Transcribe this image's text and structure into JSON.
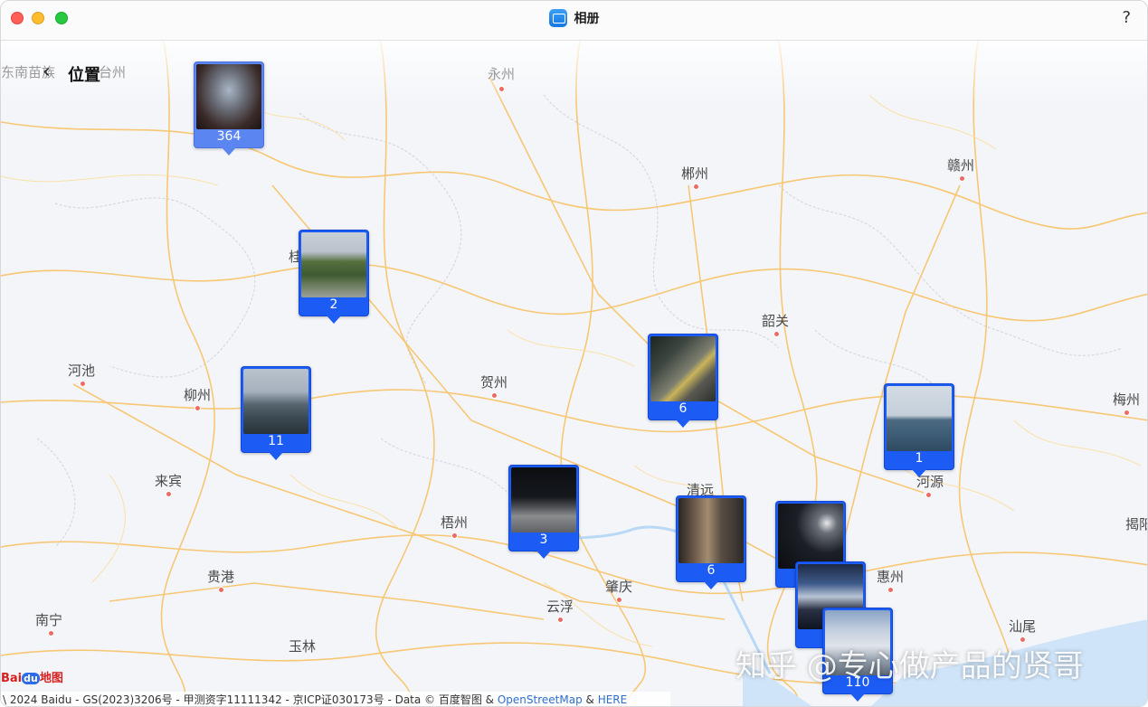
{
  "window": {
    "title": "相册",
    "help_label": "?"
  },
  "nav": {
    "back_label": "‹",
    "title": "位置"
  },
  "cities": [
    {
      "name": "东南苗族",
      "pin": false
    },
    {
      "name": "台州",
      "pin": false
    },
    {
      "name": "永州",
      "pin": true
    },
    {
      "name": "郴州",
      "pin": true
    },
    {
      "name": "赣州",
      "pin": true
    },
    {
      "name": "桂",
      "pin": false
    },
    {
      "name": "韶关",
      "pin": true
    },
    {
      "name": "河池",
      "pin": true
    },
    {
      "name": "柳州",
      "pin": true
    },
    {
      "name": "贺州",
      "pin": true
    },
    {
      "name": "梅州",
      "pin": true
    },
    {
      "name": "来宾",
      "pin": true
    },
    {
      "name": "清远",
      "pin": false
    },
    {
      "name": "河源",
      "pin": true
    },
    {
      "name": "梧州",
      "pin": true
    },
    {
      "name": "揭阳",
      "pin": false
    },
    {
      "name": "贵港",
      "pin": true
    },
    {
      "name": "肇庆",
      "pin": true
    },
    {
      "name": "惠州",
      "pin": true
    },
    {
      "name": "云浮",
      "pin": true
    },
    {
      "name": "南宁",
      "pin": true
    },
    {
      "name": "玉林",
      "pin": false
    },
    {
      "name": "汕尾",
      "pin": true
    }
  ],
  "photo_pins": [
    {
      "name": "pin-364",
      "count": "364",
      "scene": "stage"
    },
    {
      "name": "pin-2",
      "count": "2",
      "scene": "mountain"
    },
    {
      "name": "pin-11",
      "count": "11",
      "scene": "lake"
    },
    {
      "name": "pin-6-north",
      "count": "6",
      "scene": "road-night"
    },
    {
      "name": "pin-1",
      "count": "1",
      "scene": "sea"
    },
    {
      "name": "pin-3",
      "count": "3",
      "scene": "parking-night"
    },
    {
      "name": "pin-6-south",
      "count": "6",
      "scene": "street-night"
    },
    {
      "name": "pin-stack-a",
      "count": "",
      "scene": "car-night"
    },
    {
      "name": "pin-stack-b",
      "count": "",
      "scene": "building-night"
    },
    {
      "name": "pin-110",
      "count": "110",
      "scene": "cloud-sky"
    }
  ],
  "watermark": "知乎 @专心做产品的贤哥",
  "map_brand": {
    "prefix": "Bai",
    "du": "du",
    "suffix": "地图"
  },
  "attribution": {
    "text": "\\ 2024 Baidu - GS(2023)3206号 - 甲测资字11111342 - 京ICP证030173号 - Data © 百度智图 & ",
    "osm": "OpenStreetMap",
    "amp": " & ",
    "here": "HERE"
  }
}
